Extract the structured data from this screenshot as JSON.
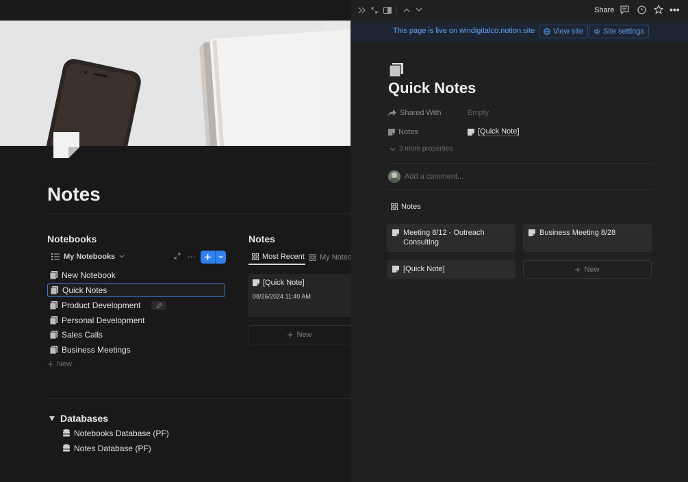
{
  "left": {
    "title": "Notes",
    "notebooks": {
      "heading": "Notebooks",
      "view_label": "My Notebooks",
      "items": [
        {
          "label": "New Notebook"
        },
        {
          "label": "Quick Notes"
        },
        {
          "label": "Product Development"
        },
        {
          "label": "Personal Development"
        },
        {
          "label": "Sales Calls"
        },
        {
          "label": "Business Meetings"
        }
      ],
      "new_label": "New"
    },
    "notes": {
      "heading": "Notes",
      "tabs": [
        {
          "label": "Most Recent"
        },
        {
          "label": "My Notes"
        }
      ],
      "card": {
        "title": "[Quick Note]",
        "date": "08/26/2024 11:40 AM"
      },
      "new_label": "New"
    },
    "databases": {
      "heading": "Databases",
      "items": [
        {
          "label": "Notebooks Database (PF)"
        },
        {
          "label": "Notes Database (PF)"
        }
      ]
    }
  },
  "right": {
    "toolbar": {
      "share_label": "Share"
    },
    "banner": {
      "text": "This page is live on windigitalco.notion.site",
      "view_site": "View site",
      "site_settings": "Site settings"
    },
    "title": "Quick Notes",
    "properties": [
      {
        "label": "Shared With",
        "value": "Empty"
      },
      {
        "label": "Notes",
        "value": "[Quick Note]"
      }
    ],
    "more_properties": "3 more properties",
    "comment_placeholder": "Add a comment...",
    "notes_view_label": "Notes",
    "cards": [
      {
        "title": "Meeting 8/12 - Outreach Consulting"
      },
      {
        "title": "Business Meeting 8/28"
      },
      {
        "title": "[Quick Note]"
      }
    ],
    "new_label": "New"
  },
  "colors": {
    "accent": "#2f80ed",
    "banner_text": "#5fa3f0",
    "background": "#191919",
    "panel": "#202020"
  }
}
